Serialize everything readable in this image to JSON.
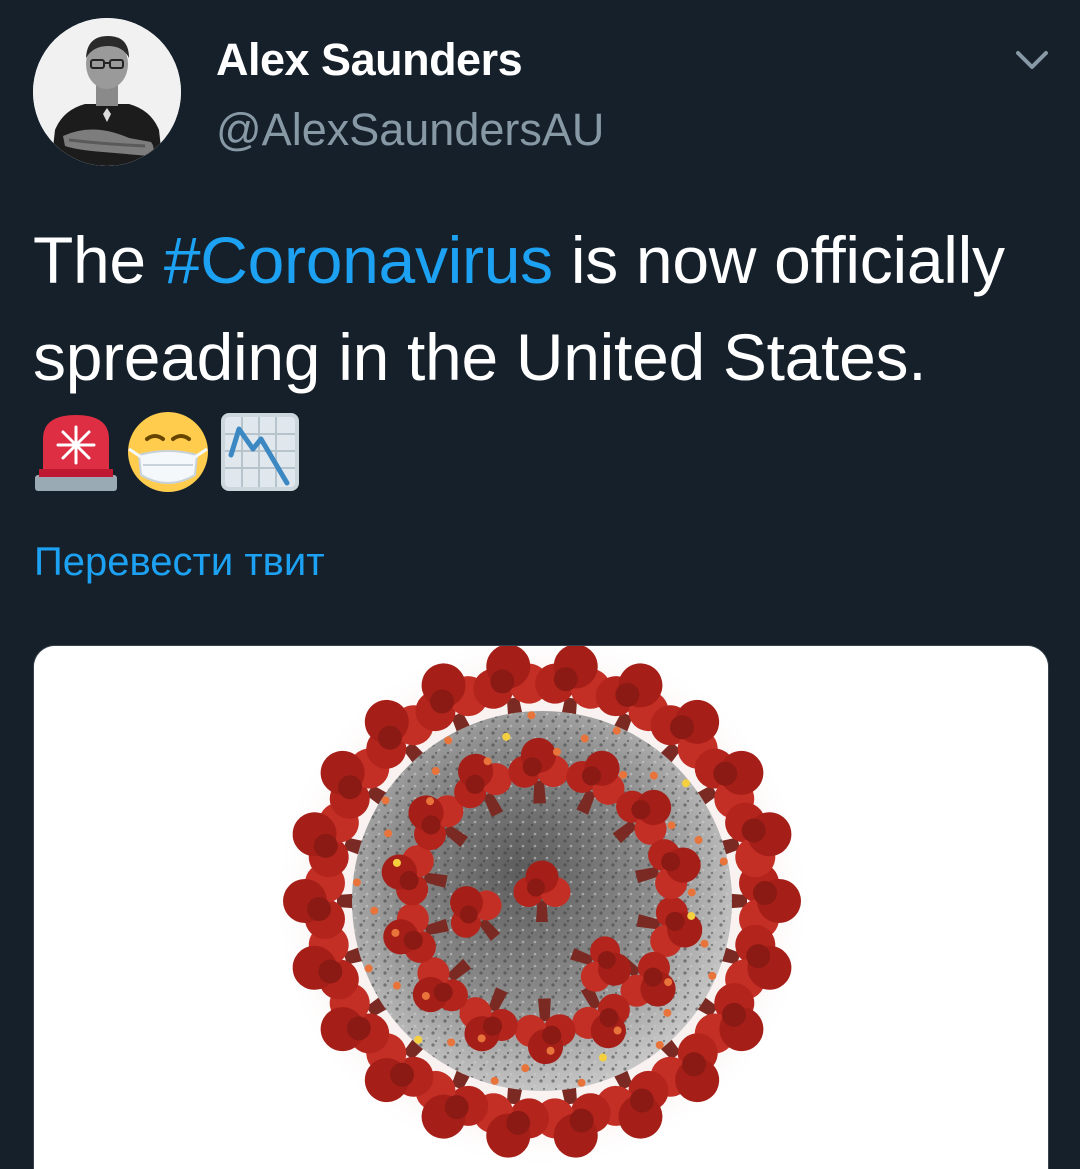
{
  "author": {
    "display_name": "Alex Saunders",
    "handle": "@AlexSaundersAU"
  },
  "tweet": {
    "text_before": "The ",
    "hashtag": "#Coronavirus",
    "text_after": " is now officially spreading in the United States. ",
    "emojis": [
      "rotating-light-icon",
      "medical-mask-face-icon",
      "chart-decreasing-icon"
    ]
  },
  "translate_label": "Перевести твит",
  "colors": {
    "background": "#15202b",
    "accent": "#1da1f2",
    "secondary_text": "#8899a6"
  }
}
